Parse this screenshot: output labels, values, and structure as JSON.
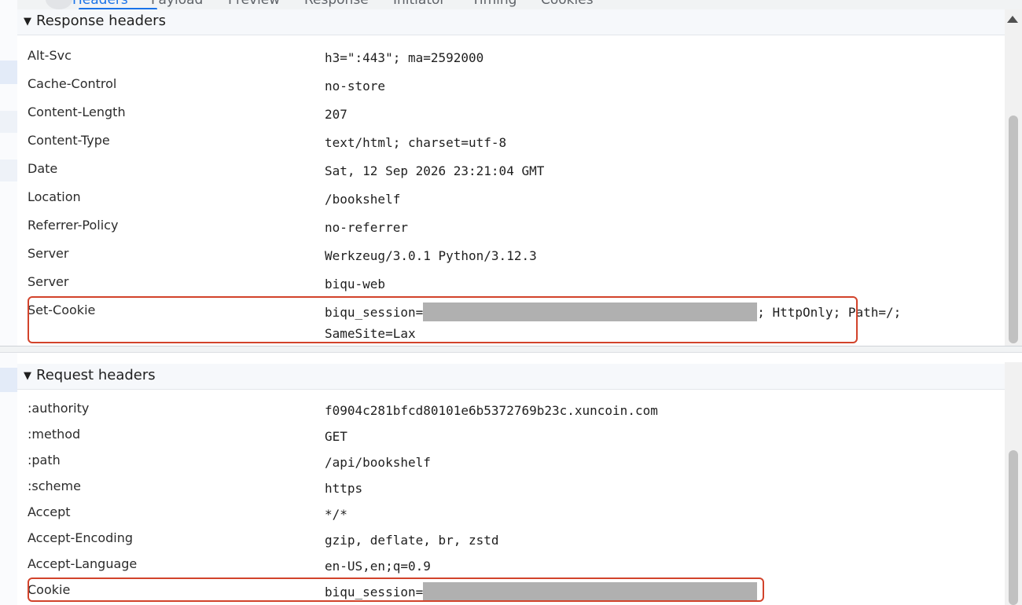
{
  "tabs": [
    {
      "label": "Headers",
      "active": true
    },
    {
      "label": "Payload",
      "active": false
    },
    {
      "label": "Preview",
      "active": false
    },
    {
      "label": "Response",
      "active": false
    },
    {
      "label": "Initiator",
      "active": false
    },
    {
      "label": "Timing",
      "active": false
    },
    {
      "label": "Cookies",
      "active": false
    }
  ],
  "response_headers": {
    "title": "Response headers",
    "expand_icon": "triangle-down-icon",
    "rows": [
      {
        "name": "Alt-Svc",
        "value": "h3=\":443\"; ma=2592000"
      },
      {
        "name": "Cache-Control",
        "value": "no-store"
      },
      {
        "name": "Content-Length",
        "value": "207"
      },
      {
        "name": "Content-Type",
        "value": "text/html; charset=utf-8"
      },
      {
        "name": "Date",
        "value": "Sat, 12 Sep 2026 23:21:04 GMT"
      },
      {
        "name": "Location",
        "value": "/bookshelf"
      },
      {
        "name": "Referrer-Policy",
        "value": "no-referrer"
      },
      {
        "name": "Server",
        "value": "Werkzeug/3.0.1 Python/3.12.3"
      },
      {
        "name": "Server",
        "value": "biqu-web"
      }
    ],
    "set_cookie": {
      "name": "Set-Cookie",
      "value_prefix": "biqu_session=",
      "value_suffix": "; HttpOnly; Path=/;",
      "value_line2": "SameSite=Lax"
    }
  },
  "request_headers": {
    "title": "Request headers",
    "expand_icon": "triangle-down-icon",
    "rows": [
      {
        "name": ":authority",
        "value": "f0904c281bfcd80101e6b5372769b23c.xuncoin.com"
      },
      {
        "name": ":method",
        "value": "GET"
      },
      {
        "name": ":path",
        "value": "/api/bookshelf"
      },
      {
        "name": ":scheme",
        "value": "https"
      },
      {
        "name": "Accept",
        "value": "*/*"
      },
      {
        "name": "Accept-Encoding",
        "value": "gzip, deflate, br, zstd"
      },
      {
        "name": "Accept-Language",
        "value": "en-US,en;q=0.9"
      }
    ],
    "cookie": {
      "name": "Cookie",
      "value_prefix": "biqu_session="
    }
  },
  "colors": {
    "highlight": "#d2432b",
    "redaction": "#b0b0b0",
    "accent": "#1a73e8"
  }
}
